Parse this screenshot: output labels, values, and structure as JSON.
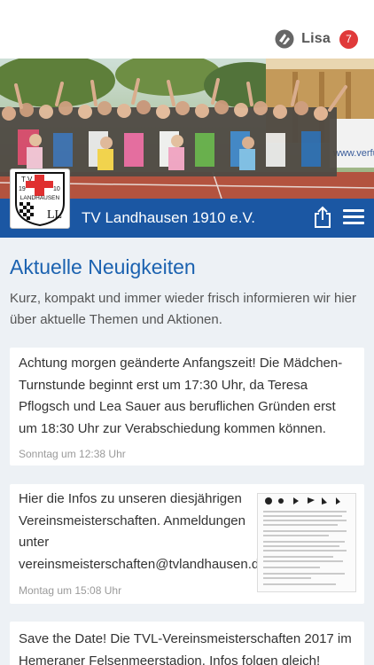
{
  "topbar": {
    "logo_icon": "app-logo-icon",
    "user_name": "Lisa",
    "notification_count": "7",
    "badge_color": "#e03a3a"
  },
  "club": {
    "name": "TV Landhausen 1910 e.V.",
    "logo_text_top": "T V",
    "logo_year_left": "19",
    "logo_year_right": "10",
    "logo_name": "LANDHAUSEN",
    "logo_initials": "LL",
    "bar_color": "#1b57a3",
    "share_icon": "share-icon",
    "menu_icon": "hamburger-menu-icon"
  },
  "hero": {
    "banner_text": "www.verfu"
  },
  "news": {
    "title": "Aktuelle Neuigkeiten",
    "description": "Kurz, kompakt und immer wieder frisch informieren wir hier über aktuelle Themen und Aktionen.",
    "items": [
      {
        "text": "Achtung morgen geänderte Anfangszeit! Die Mädchen-Turnstunde beginnt erst um 17:30 Uhr, da Teresa Pflogsch und Lea Sauer aus beruflichen Gründen erst um 18:30 Uhr zur Verabschiedung kommen können.",
        "time": "Sonntag um 12:38 Uhr"
      },
      {
        "line1": "Hier die Infos zu unseren diesjährigen",
        "line2": "Vereinsmeisterschaften. Anmeldungen",
        "line3": "unter",
        "line4": "vereinsmeisterschaften@tvlandhausen.de",
        "time": "Montag um 15:08 Uhr"
      },
      {
        "text": "Save the Date! Die TVL-Vereinsmeisterschaften 2017 im Hemeraner Felsenmeerstadion. Infos folgen gleich!"
      }
    ]
  }
}
